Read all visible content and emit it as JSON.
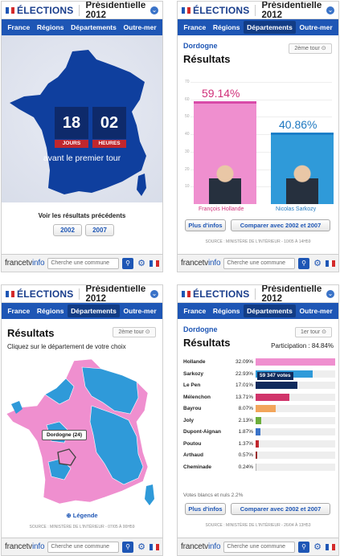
{
  "app": {
    "brand": "ÉLECTIONS",
    "title": "Présidentielle 2012"
  },
  "nav": {
    "items": [
      "France",
      "Régions",
      "Départements",
      "Outre-mer"
    ]
  },
  "footer": {
    "logo_a": "francetv",
    "logo_b": "info",
    "search_placeholder": "Cherche une commune"
  },
  "colors": {
    "nav": "#1e56b5",
    "hollande": "#ef8fcf",
    "sarkozy": "#2f9ad9",
    "flag_blue": "#1e56b5",
    "flag_red": "#d42a2a"
  },
  "panel1": {
    "days": "18",
    "days_label": "JOURS",
    "hours": "02",
    "hours_label": "HEURES",
    "countdown_text": "avant le premier tour",
    "prev_label": "Voir les résultats précédents",
    "years": [
      "2002",
      "2007"
    ]
  },
  "panel2": {
    "dept": "Dordogne",
    "heading": "Résultats",
    "tour": "2ème tour",
    "y_ticks": [
      "70",
      "60",
      "50",
      "40",
      "30",
      "20",
      "10"
    ],
    "candidates": [
      {
        "name": "François Hollande",
        "pct": "59.14%",
        "value": 59.14
      },
      {
        "name": "Nicolas Sarkozy",
        "pct": "40.86%",
        "value": 40.86
      }
    ],
    "btn_more": "Plus d'infos",
    "btn_compare": "Comparer avec 2002 et 2007",
    "source": "SOURCE : MINISTÈRE DE L'INTÉRIEUR - 10/05 À 14H59"
  },
  "panel3": {
    "heading": "Résultats",
    "tour": "2ème tour",
    "instruction": "Cliquez sur le département de votre choix",
    "tooltip": "Dordogne (24)",
    "legend": "Légende",
    "source": "SOURCE : MINISTÈRE DE L'INTÉRIEUR - 07/05 À 00H59"
  },
  "panel4": {
    "dept": "Dordogne",
    "heading": "Résultats",
    "tour": "1er tour",
    "participation": "Participation : 84.84%",
    "votes_tooltip": "59 347 votes",
    "blank": "Votes blancs et nuls 2.2%",
    "btn_more": "Plus d'infos",
    "btn_compare": "Comparer avec 2002 et 2007",
    "source": "SOURCE : MINISTÈRE DE L'INTÉRIEUR - 26/04 À 13H53"
  },
  "chart_data": [
    {
      "type": "bar",
      "title": "Résultats",
      "categories": [
        "François Hollande",
        "Nicolas Sarkozy"
      ],
      "values": [
        59.14,
        40.86
      ],
      "ylim": [
        0,
        70
      ]
    },
    {
      "type": "bar",
      "title": "Résultats",
      "categories": [
        "Hollande",
        "Sarkozy",
        "Le Pen",
        "Mélenchon",
        "Bayrou",
        "Joly",
        "Dupont-Aignan",
        "Poutou",
        "Arthaud",
        "Cheminade"
      ],
      "values": [
        32.09,
        22.93,
        17.01,
        13.71,
        8.07,
        2.13,
        1.87,
        1.37,
        0.57,
        0.24
      ],
      "labels": [
        "32.09%",
        "22.93%",
        "17.01%",
        "13.71%",
        "8.07%",
        "2.13%",
        "1.87%",
        "1.37%",
        "0.57%",
        "0.24%"
      ],
      "colors": [
        "#ef8fcf",
        "#2f9ad9",
        "#0f2a5c",
        "#d0346a",
        "#f2a55a",
        "#6cae3c",
        "#3a73c8",
        "#c0272d",
        "#9a2a2a",
        "#b0b0b0"
      ],
      "xlim": [
        0,
        32.09
      ]
    }
  ]
}
